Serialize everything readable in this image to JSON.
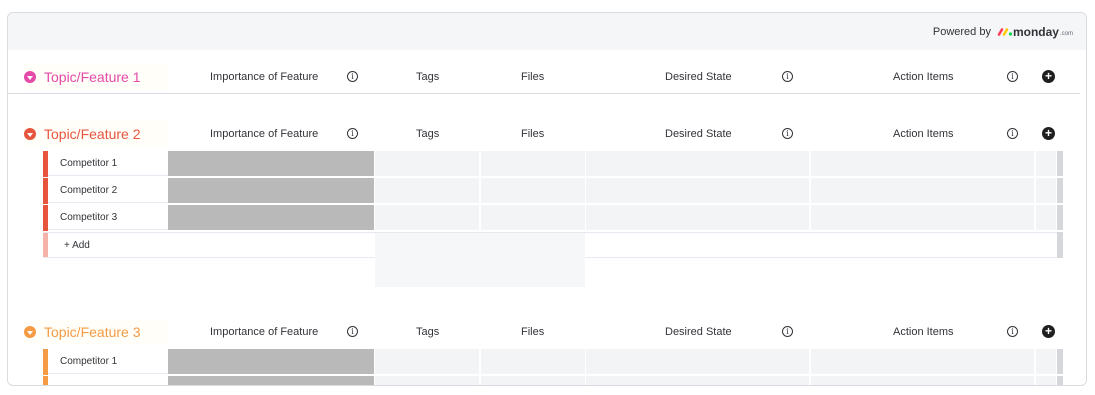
{
  "powered_by": {
    "label": "Powered by",
    "brand": "monday",
    "brand_suffix": ".com"
  },
  "columns": {
    "importance": "Importance of Feature",
    "tags": "Tags",
    "files": "Files",
    "desired_state": "Desired State",
    "action_items": "Action Items",
    "info_glyph": "i",
    "add_glyph": "+"
  },
  "groups": [
    {
      "title": "Topic/Feature 1",
      "color": "#e44aa8",
      "rows": []
    },
    {
      "title": "Topic/Feature 2",
      "color": "#e8553f",
      "rows": [
        "Competitor 1",
        "Competitor 2",
        "Competitor 3"
      ],
      "add_label": "+ Add"
    },
    {
      "title": "Topic/Feature 3",
      "color": "#f59a45",
      "rows": [
        "Competitor 1"
      ]
    }
  ],
  "colors": {
    "gray_cell": "#b9b9b9",
    "light_cell": "#f3f4f6",
    "header_bg": "#f5f6f8"
  }
}
